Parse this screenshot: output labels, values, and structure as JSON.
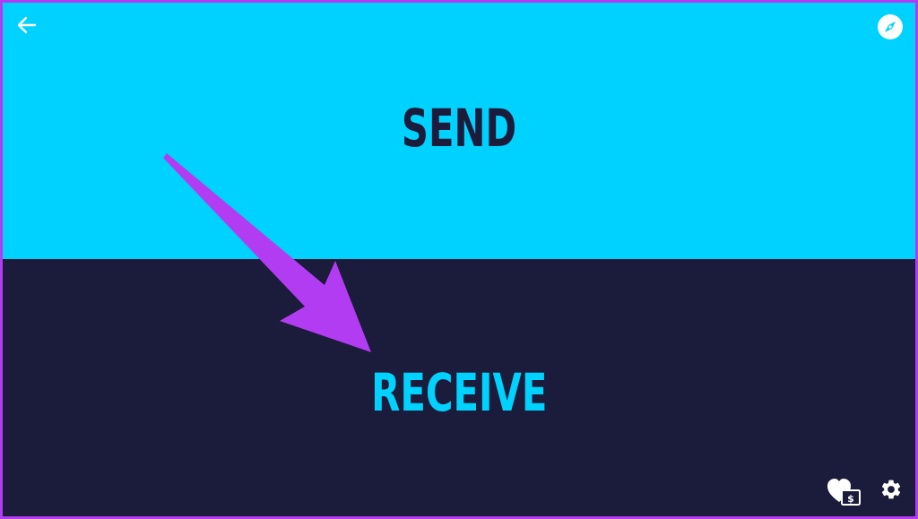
{
  "send": {
    "label": "SEND"
  },
  "receive": {
    "label": "RECEIVE"
  },
  "toolbar": {
    "back_icon": "back-arrow-icon",
    "compass_icon": "compass-icon",
    "donate_icon": "heart-dollar-icon",
    "settings_icon": "gear-icon"
  },
  "colors": {
    "accent_cyan": "#00d2ff",
    "dark_navy": "#1b1b3b",
    "annotation_purple": "#b23cf2"
  }
}
